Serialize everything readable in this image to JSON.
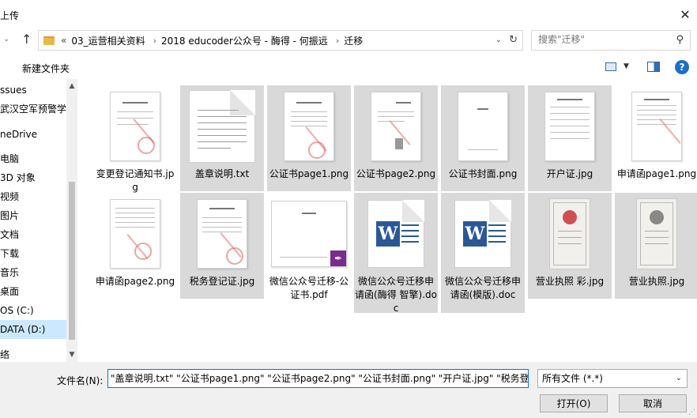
{
  "window": {
    "title": "上传",
    "close_glyph": "✕"
  },
  "address": {
    "chevron": "«",
    "crumbs": [
      "03_运营相关资料",
      "2018 educoder公众号 - 酶得 - 何振远",
      "迁移"
    ],
    "separator": "›"
  },
  "search": {
    "placeholder": "搜索\"迁移\""
  },
  "toolbar": {
    "new_folder": "新建文件夹",
    "help": "?"
  },
  "sidebar": {
    "items": [
      {
        "label": "ssues",
        "selected": false
      },
      {
        "label": "武汉空军预警学I",
        "selected": false
      },
      {
        "label": "neDrive",
        "selected": false
      },
      {
        "label": "电脑",
        "selected": false
      },
      {
        "label": "3D 对象",
        "selected": false
      },
      {
        "label": "视频",
        "selected": false
      },
      {
        "label": "图片",
        "selected": false
      },
      {
        "label": "文档",
        "selected": false
      },
      {
        "label": "下载",
        "selected": false
      },
      {
        "label": "音乐",
        "selected": false
      },
      {
        "label": "桌面",
        "selected": false
      },
      {
        "label": "OS (C:)",
        "selected": false
      },
      {
        "label": "DATA (D:)",
        "selected": true
      },
      {
        "label": "络",
        "selected": false
      }
    ]
  },
  "files": [
    {
      "name": "变更登记通知书.jpg",
      "kind": "scan",
      "selected": false
    },
    {
      "name": "盖章说明.txt",
      "kind": "txt",
      "selected": true
    },
    {
      "name": "公证书page1.png",
      "kind": "scan",
      "selected": true
    },
    {
      "name": "公证书page2.png",
      "kind": "scan",
      "selected": true
    },
    {
      "name": "公证书封面.png",
      "kind": "cover",
      "selected": true
    },
    {
      "name": "开户证.jpg",
      "kind": "scan",
      "selected": true
    },
    {
      "name": "申请函page1.png",
      "kind": "scan",
      "selected": false
    },
    {
      "name": "申请函page2.png",
      "kind": "scan",
      "selected": false
    },
    {
      "name": "税务登记证.jpg",
      "kind": "scan",
      "selected": true
    },
    {
      "name": "微信公众号迁移-公证书.pdf",
      "kind": "pdf",
      "selected": false
    },
    {
      "name": "微信公众号迁移申请函(酶得 智擎).doc",
      "kind": "word",
      "selected": true
    },
    {
      "name": "微信公众号迁移申请函(模版).doc",
      "kind": "word",
      "selected": true
    },
    {
      "name": "营业执照 彩.jpg",
      "kind": "cert-color",
      "selected": true
    },
    {
      "name": "营业执照.jpg",
      "kind": "cert-gray",
      "selected": true
    }
  ],
  "bottom": {
    "filename_label": "文件名(N):",
    "filename_value": "\"盖章说明.txt\" \"公证书page1.png\" \"公证书page2.png\" \"公证书封面.png\" \"开户证.jpg\" \"税务登",
    "filetype": "所有文件 (*.*)",
    "open": "打开(O)",
    "cancel": "取消"
  }
}
